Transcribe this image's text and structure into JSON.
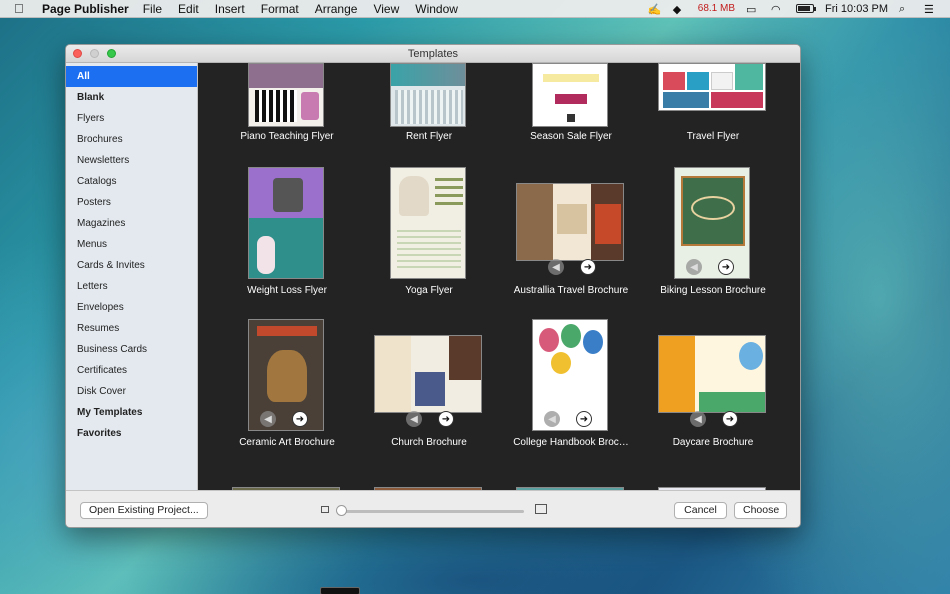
{
  "menubar": {
    "app_name": "Page Publisher",
    "menus": [
      "File",
      "Edit",
      "Insert",
      "Format",
      "Arrange",
      "View",
      "Window"
    ],
    "memory": "68.1 MB",
    "clock": "Fri 10:03 PM",
    "battery_level": 0.85
  },
  "window": {
    "title": "Templates"
  },
  "sidebar": {
    "items": [
      {
        "label": "All",
        "selected": true,
        "bold": true
      },
      {
        "label": "Blank",
        "bold": true
      },
      {
        "label": "Flyers"
      },
      {
        "label": "Brochures"
      },
      {
        "label": "Newsletters"
      },
      {
        "label": "Catalogs"
      },
      {
        "label": "Posters"
      },
      {
        "label": "Magazines"
      },
      {
        "label": "Menus"
      },
      {
        "label": "Cards & Invites"
      },
      {
        "label": "Letters"
      },
      {
        "label": "Envelopes"
      },
      {
        "label": "Resumes"
      },
      {
        "label": "Business Cards"
      },
      {
        "label": "Certificates"
      },
      {
        "label": "Disk Cover"
      },
      {
        "label": "My Templates",
        "bold": true
      },
      {
        "label": "Favorites",
        "bold": true
      }
    ]
  },
  "templates": [
    {
      "label": "Piano Teaching Flyer",
      "accent": "#6b4b6b"
    },
    {
      "label": "Rent Flyer",
      "accent": "#5c8fa0"
    },
    {
      "label": "Season Sale Flyer",
      "accent": "#b12b5c"
    },
    {
      "label": "Travel Flyer",
      "accent": "#d94b5b"
    },
    {
      "label": "Weight Loss Flyer",
      "accent": "#9b6fcc"
    },
    {
      "label": "Yoga Flyer",
      "accent": "#7fae6b"
    },
    {
      "label": "Australlia Travel Brochure",
      "accent": "#7a5a3a"
    },
    {
      "label": "Biking Lesson Brochure",
      "accent": "#2f5d3e"
    },
    {
      "label": "Ceramic Art Brochure",
      "accent": "#4a4038"
    },
    {
      "label": "Church Brochure",
      "accent": "#8a6a4a"
    },
    {
      "label": "College Handbook Broc…",
      "accent": "#d85a7a"
    },
    {
      "label": "Daycare Brochure",
      "accent": "#f0a020"
    }
  ],
  "footer": {
    "open_label": "Open Existing Project...",
    "cancel_label": "Cancel",
    "choose_label": "Choose",
    "zoom_level": 0.0
  }
}
